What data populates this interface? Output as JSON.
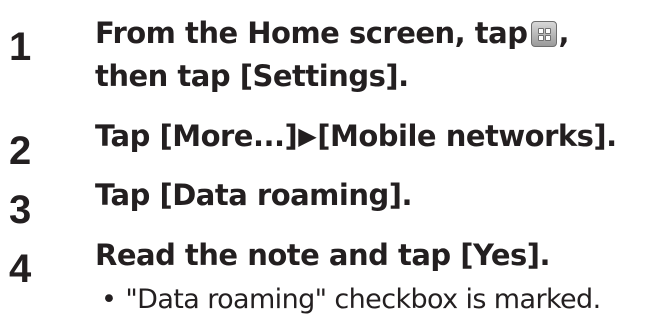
{
  "steps": [
    {
      "number": "1",
      "line1_before_icon": "From the Home screen, tap",
      "icon": "app-grid-icon",
      "line1_after_icon": ",",
      "line2": "then tap [Settings]."
    },
    {
      "number": "2",
      "text_before_arrow": "Tap [More...]",
      "arrow": "▶",
      "text_after_arrow": "[Mobile networks]."
    },
    {
      "number": "3",
      "text": "Tap [Data roaming]."
    },
    {
      "number": "4",
      "text": "Read the note and tap [Yes]."
    }
  ],
  "note": {
    "bullet": "•",
    "text": "\"Data roaming\" checkbox is marked."
  }
}
